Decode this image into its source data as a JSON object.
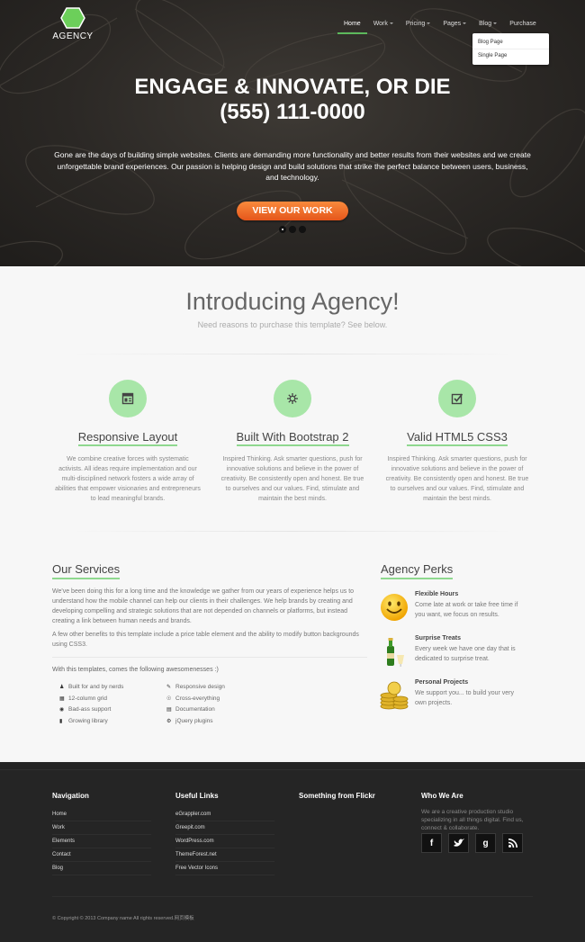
{
  "brand": {
    "name": "AGENCY",
    "color": "#5cb85c"
  },
  "nav": {
    "items": [
      {
        "label": "Home",
        "active": true,
        "caret": false
      },
      {
        "label": "Work",
        "active": false,
        "caret": true
      },
      {
        "label": "Pricing",
        "active": false,
        "caret": true
      },
      {
        "label": "Pages",
        "active": false,
        "caret": true
      },
      {
        "label": "Blog",
        "active": false,
        "caret": true
      },
      {
        "label": "Purchase",
        "active": false,
        "caret": false
      }
    ],
    "dropdown": [
      "Blog Page",
      "Single Page"
    ]
  },
  "hero": {
    "title_line1": "ENGAGE & INNOVATE, OR DIE",
    "title_line2": "(555) 111-0000",
    "subtitle": "Gone are the days of building simple websites. Clients are demanding more functionality and better results from their websites and we create unforgettable brand experiences. Our passion is helping design and build solutions that strike the perfect balance between users, business, and technology.",
    "cta": "VIEW OUR WORK"
  },
  "intro": {
    "title": "Introducing Agency!",
    "subtitle": "Need reasons to purchase this template? See below."
  },
  "features": [
    {
      "icon": "layout-icon",
      "title": "Responsive Layout",
      "text": "We combine creative forces with systematic activists. All ideas require implementation and our multi-disciplined network fosters a wide array of abilities that empower visionaries and entrepreneurs to lead meaningful brands."
    },
    {
      "icon": "gear-icon",
      "title": "Built With Bootstrap 2",
      "text": "Inspired Thinking. Ask smarter questions, push for innovative solutions and believe in the power of creativity. Be consistently open and honest. Be true to ourselves and our values. Find, stimulate and maintain the best minds."
    },
    {
      "icon": "checkbox-icon",
      "title": "Valid HTML5 CSS3",
      "text": "Inspired Thinking. Ask smarter questions, push for innovative solutions and believe in the power of creativity. Be consistently open and honest. Be true to ourselves and our values. Find, stimulate and maintain the best minds."
    }
  ],
  "services": {
    "title": "Our Services",
    "p1": "We've been doing this for a long time and the knowledge we gather from our years of experience helps us to understand how the mobile channel can help our clients in their challenges. We help brands by creating and developing compelling and strategic solutions that are not depended on channels or platforms, but instead creating a link between human needs and brands.",
    "p2": "A few other benefits to this template include a price table element and the ability to modify button backgrounds using CSS3.",
    "awesome": "With this templates, comes the following awesomenesses :)",
    "list_left": [
      {
        "icon": "user-icon",
        "label": "Built for and by nerds"
      },
      {
        "icon": "grid-icon",
        "label": "12-column grid"
      },
      {
        "icon": "globe-icon",
        "label": "Bad-ass support"
      },
      {
        "icon": "book-icon",
        "label": "Growing library"
      }
    ],
    "list_right": [
      {
        "icon": "pencil-icon",
        "label": "Responsive design"
      },
      {
        "icon": "eye-icon",
        "label": "Cross-everything"
      },
      {
        "icon": "document-icon",
        "label": "Documentation"
      },
      {
        "icon": "cog-icon",
        "label": "jQuery plugins"
      }
    ]
  },
  "perks": {
    "title": "Agency Perks",
    "items": [
      {
        "icon": "smiley-icon",
        "title": "Flexible Hours",
        "text": "Come late at work or take free time if you want, we focus on results."
      },
      {
        "icon": "champagne-icon",
        "title": "Surprise Treats",
        "text": "Every week we have one day that is dedicated to surprise treat."
      },
      {
        "icon": "coins-icon",
        "title": "Personal Projects",
        "text": "We support you... to build your very own projects."
      }
    ]
  },
  "footer": {
    "navigation": {
      "title": "Navigation",
      "links": [
        "Home",
        "Work",
        "Elements",
        "Contact",
        "Blog"
      ]
    },
    "useful": {
      "title": "Useful Links",
      "links": [
        "eGrappler.com",
        "Greepit.com",
        "WordPress.com",
        "ThemeForest.net",
        "Free Vector Icons"
      ]
    },
    "flickr": {
      "title": "Something from Flickr"
    },
    "who": {
      "title": "Who We Are",
      "text": "We are a creative production studio specializing in all things digital. Find us, connect & collaborate."
    },
    "social": [
      {
        "icon": "facebook-icon",
        "glyph": "f"
      },
      {
        "icon": "twitter-icon",
        "glyph": "t"
      },
      {
        "icon": "google-plus-icon",
        "glyph": "g"
      },
      {
        "icon": "rss-icon",
        "glyph": "rss"
      }
    ],
    "copyright": "© Copyright © 2013 Company name All rights reserved.网页模板"
  }
}
